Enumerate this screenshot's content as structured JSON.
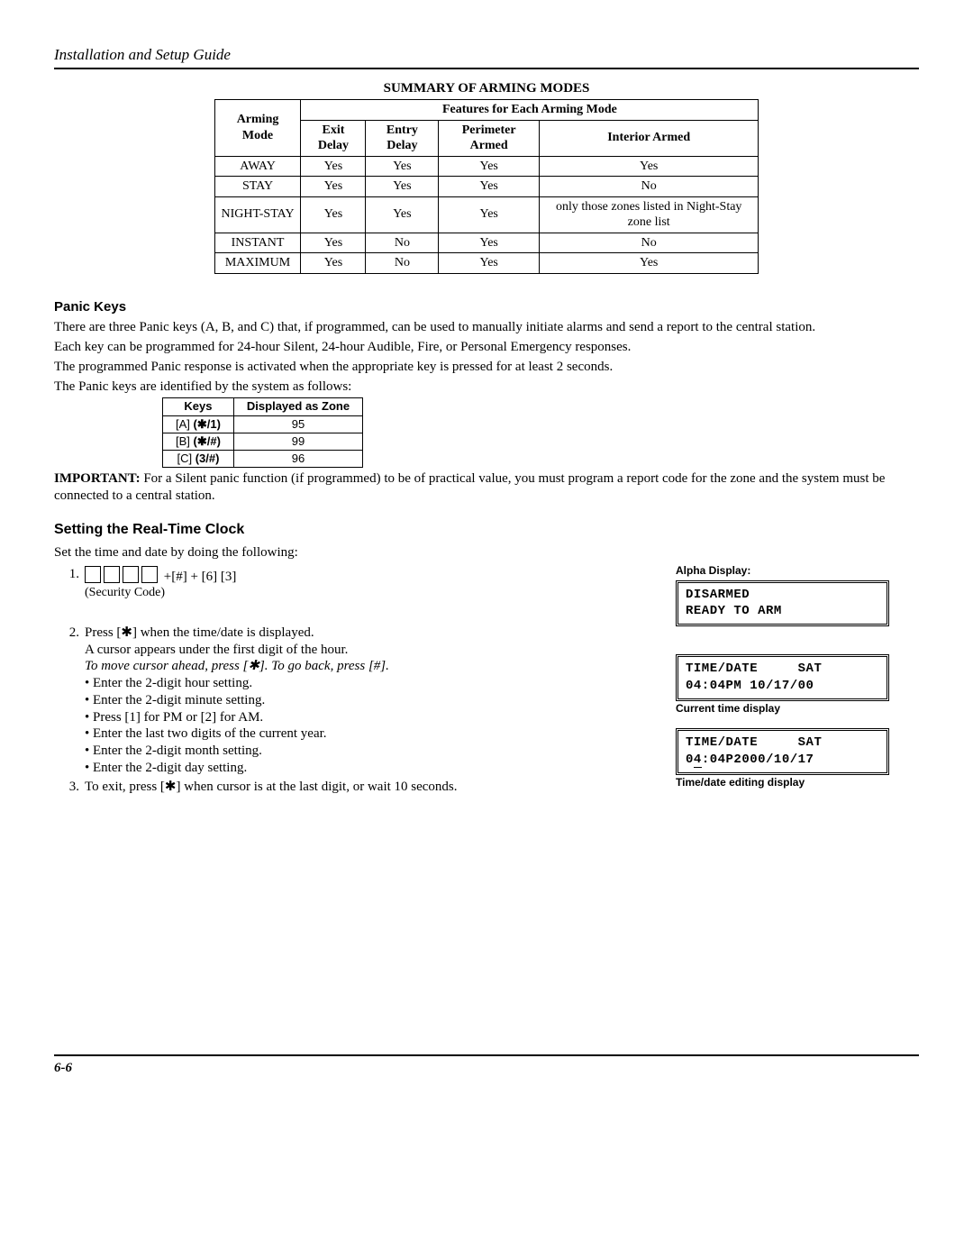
{
  "header": {
    "title": "Installation and Setup Guide"
  },
  "summary": {
    "title": "SUMMARY OF ARMING MODES",
    "col_mode": "Arming Mode",
    "features_span": "Features for Each Arming Mode",
    "cols": [
      "Exit Delay",
      "Entry Delay",
      "Perimeter Armed",
      "Interior Armed"
    ],
    "rows": [
      {
        "mode": "AWAY",
        "vals": [
          "Yes",
          "Yes",
          "Yes",
          "Yes"
        ]
      },
      {
        "mode": "STAY",
        "vals": [
          "Yes",
          "Yes",
          "Yes",
          "No"
        ]
      },
      {
        "mode": "NIGHT-STAY",
        "vals": [
          "Yes",
          "Yes",
          "Yes",
          "only those zones listed in Night-Stay zone list"
        ]
      },
      {
        "mode": "INSTANT",
        "vals": [
          "Yes",
          "No",
          "Yes",
          "No"
        ]
      },
      {
        "mode": "MAXIMUM",
        "vals": [
          "Yes",
          "No",
          "Yes",
          "Yes"
        ]
      }
    ]
  },
  "panic": {
    "heading": "Panic Keys",
    "p1": "There are three Panic keys (A, B, and C) that, if programmed, can be used to manually initiate alarms and send a report to the central station.",
    "p2": "Each key can be programmed for 24-hour Silent, 24-hour Audible, Fire, or Personal Emergency responses.",
    "p3": "The programmed Panic response is activated when the appropriate key is pressed for at least 2 seconds.",
    "p4": "The Panic keys are identified by the system as follows:",
    "tbl_h1": "Keys",
    "tbl_h2": "Displayed as Zone",
    "k": [
      {
        "pre": "[A] ",
        "b": "(✱/1)",
        "z": "95"
      },
      {
        "pre": "[B] ",
        "b": "(✱/#)",
        "z": "99"
      },
      {
        "pre": "[C] ",
        "b": "(3/#)",
        "z": "96"
      }
    ],
    "imp_label": "IMPORTANT:",
    "imp_text": " For a Silent panic function (if programmed) to be of practical value, you must program a report code for the zone and the system must be connected to a central station."
  },
  "rtc": {
    "heading": "Setting the Real-Time Clock",
    "intro": "Set the time and date by doing the following:",
    "step1_num": "1.",
    "step1_tail": " +[#] + [6] [3]",
    "step1_sub": "(Security Code)",
    "step2_num": "2.",
    "step2_l1": "Press [✱] when the time/date is displayed.",
    "step2_l2": "A cursor appears under the first digit of the hour.",
    "step2_l3": "To move cursor ahead, press [✱]. To go back, press [#].",
    "step2_b": [
      "Enter the 2-digit hour setting.",
      "Enter the 2-digit minute setting.",
      "Press [1] for PM or [2] for AM.",
      "Enter the last two digits of the current year.",
      "Enter the 2-digit month setting.",
      "Enter the 2-digit day setting."
    ],
    "step3_num": "3.",
    "step3": "To exit, press [✱] when cursor is at the last digit, or wait 10 seconds."
  },
  "rcol": {
    "alpha": "Alpha Display:",
    "box1": "DISARMED\nREADY TO ARM",
    "box2_l1a": "TIME/DATE",
    "box2_l1b": "SAT",
    "box2_l2": "04:04PM 10/17/00",
    "box2_cap": "Current time display",
    "box3_l1a": "TIME/DATE",
    "box3_l1b": "SAT",
    "box3_l2_pre": "0",
    "box3_l2_u": "4",
    "box3_l2_post": ":04P2000/10/17",
    "box3_cap": "Time/date editing display"
  },
  "footer": {
    "page": "6-6"
  }
}
